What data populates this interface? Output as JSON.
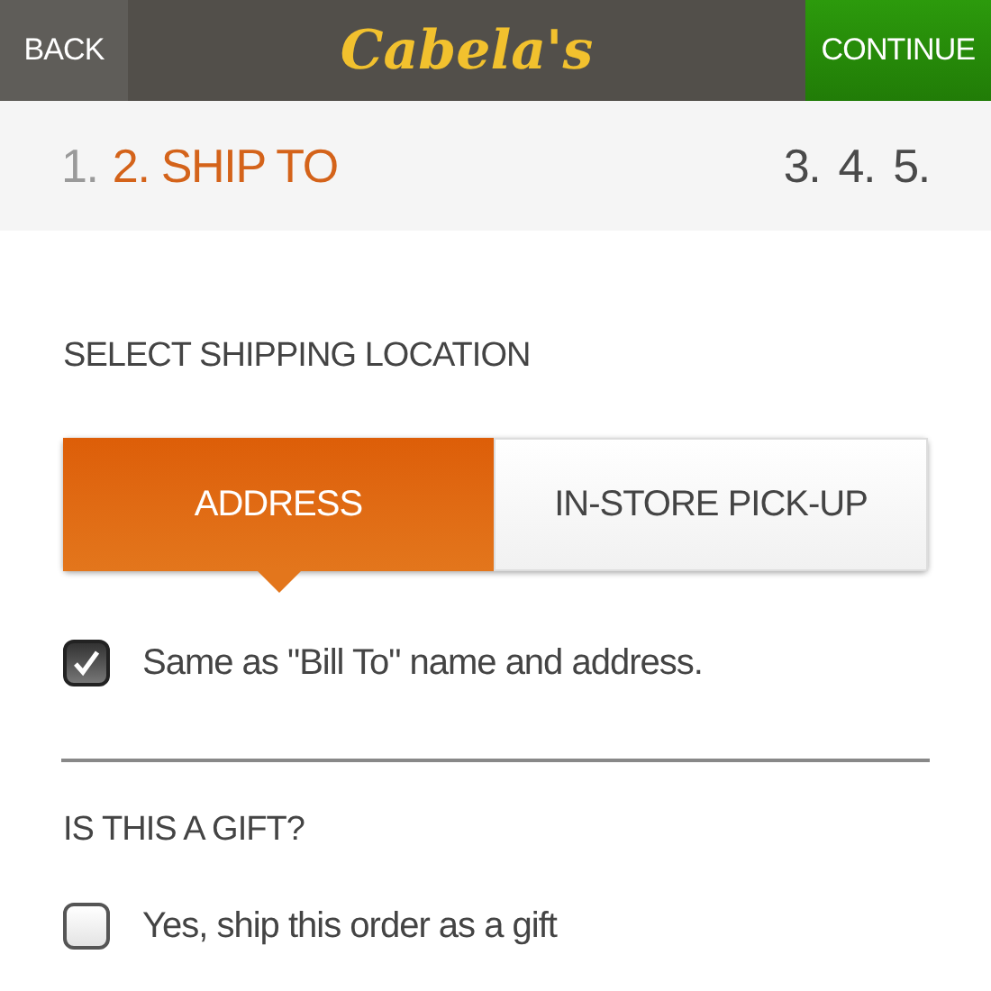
{
  "header": {
    "back": "BACK",
    "logo": "Cabela's",
    "continue": "CONTINUE"
  },
  "steps": [
    {
      "label": "1.",
      "selected": false,
      "completed": true
    },
    {
      "label": "2. SHIP TO",
      "selected": true,
      "completed": false
    },
    {
      "label": "3.",
      "selected": false,
      "completed": false
    },
    {
      "label": "4.",
      "selected": false,
      "completed": false
    },
    {
      "label": "5.",
      "selected": false,
      "completed": false
    }
  ],
  "shipping": {
    "heading": "SELECT SHIPPING LOCATION",
    "options": [
      {
        "label": "ADDRESS",
        "selected": true
      },
      {
        "label": "IN-STORE PICK-UP",
        "selected": false
      }
    ],
    "same_as_bill_to": {
      "label": "Same as \"Bill To\" name and address.",
      "checked": true
    }
  },
  "gift": {
    "heading": "IS THIS A GIFT?",
    "option": {
      "label": "Yes, ship this order as a gift",
      "checked": false
    }
  }
}
